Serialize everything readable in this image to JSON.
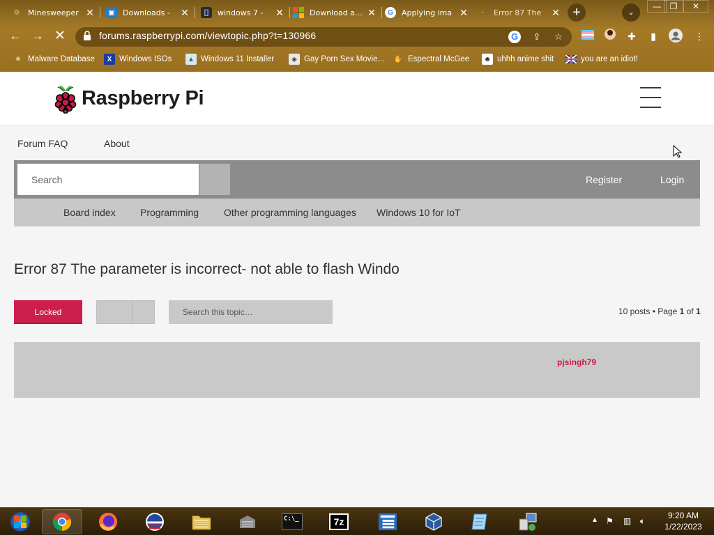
{
  "browser": {
    "tabs": [
      {
        "title": "Minesweeper",
        "icon": "gear-icon",
        "color": "#3a2a10"
      },
      {
        "title": "Downloads - ",
        "icon": "folder-image-icon",
        "color": "#2a78c8"
      },
      {
        "title": "windows 7 - ",
        "icon": "bracket-icon",
        "color": "#3a5ac8"
      },
      {
        "title": "Download and",
        "icon": "microsoft-icon",
        "color": "#f25022"
      },
      {
        "title": "Applying ima",
        "icon": "google-icon",
        "color": "#ffffff"
      },
      {
        "title": "Error 87 The",
        "icon": "raspberry-icon",
        "color": "#c51d4a"
      }
    ],
    "new_tab": "+",
    "tab_dropdown": "⌄",
    "window_controls": {
      "minimize": "—",
      "restore": "❐",
      "close": "✕"
    },
    "nav": {
      "back": "←",
      "forward": "→",
      "reload": "✕"
    },
    "url": "forums.raspberrypi.com/viewtopic.php?t=130966",
    "bookmarks": [
      {
        "label": "Malware Database",
        "icon": "spider-icon"
      },
      {
        "label": "Windows ISOs",
        "icon": "x-logo-icon"
      },
      {
        "label": "Windows 11 Installer",
        "icon": "image-icon"
      },
      {
        "label": "Gay Porn Sex Movie...",
        "icon": "badge-icon"
      },
      {
        "label": "Espectral McGee",
        "icon": "hand-icon"
      },
      {
        "label": "uhhh anime shit",
        "icon": "anime-face-icon"
      },
      {
        "label": "you are an idiot!",
        "icon": "flag-icon"
      }
    ]
  },
  "site": {
    "name": "Raspberry Pi",
    "top_links": [
      "Forum FAQ",
      "About"
    ],
    "search_placeholder": "Search",
    "auth": {
      "register": "Register",
      "login": "Login"
    },
    "breadcrumbs": [
      "Board index",
      "Programming",
      "Other programming languages",
      "Windows 10 for IoT"
    ],
    "topic_title": "Error 87 The parameter is incorrect- not able to flash Windo",
    "locked_label": "Locked",
    "topic_search_placeholder": "Search this topic…",
    "page_info": {
      "prefix": "10 posts • Page ",
      "current": "1",
      "middle": " of ",
      "total": "1"
    },
    "post_author": "pjsingh79"
  },
  "taskbar": {
    "apps": [
      {
        "name": "start-orb-icon",
        "label": "",
        "color": "#2a7ad8"
      },
      {
        "name": "chrome-icon",
        "label": "",
        "color": "#e0b020"
      },
      {
        "name": "firefox-icon",
        "label": "",
        "color": "#e86a1a"
      },
      {
        "name": "obama-logo-icon",
        "label": "",
        "color": "#1e4aa0"
      },
      {
        "name": "file-explorer-icon",
        "label": "",
        "color": "#e8c050"
      },
      {
        "name": "archive-icon",
        "label": "",
        "color": "#7a7a7a"
      },
      {
        "name": "command-prompt-icon",
        "label": "C:\\_",
        "color": "#111111"
      },
      {
        "name": "seven-zip-icon",
        "label": "7z",
        "color": "#111111"
      },
      {
        "name": "device-manager-icon",
        "label": "",
        "color": "#2a6ab8"
      },
      {
        "name": "virtualbox-icon",
        "label": "",
        "color": "#2a5a9a"
      },
      {
        "name": "notepad-icon",
        "label": "",
        "color": "#6aa8d8"
      },
      {
        "name": "network-setup-icon",
        "label": "",
        "color": "#5a8ac8"
      }
    ],
    "time": "9:20 AM",
    "date": "1/22/2023"
  }
}
